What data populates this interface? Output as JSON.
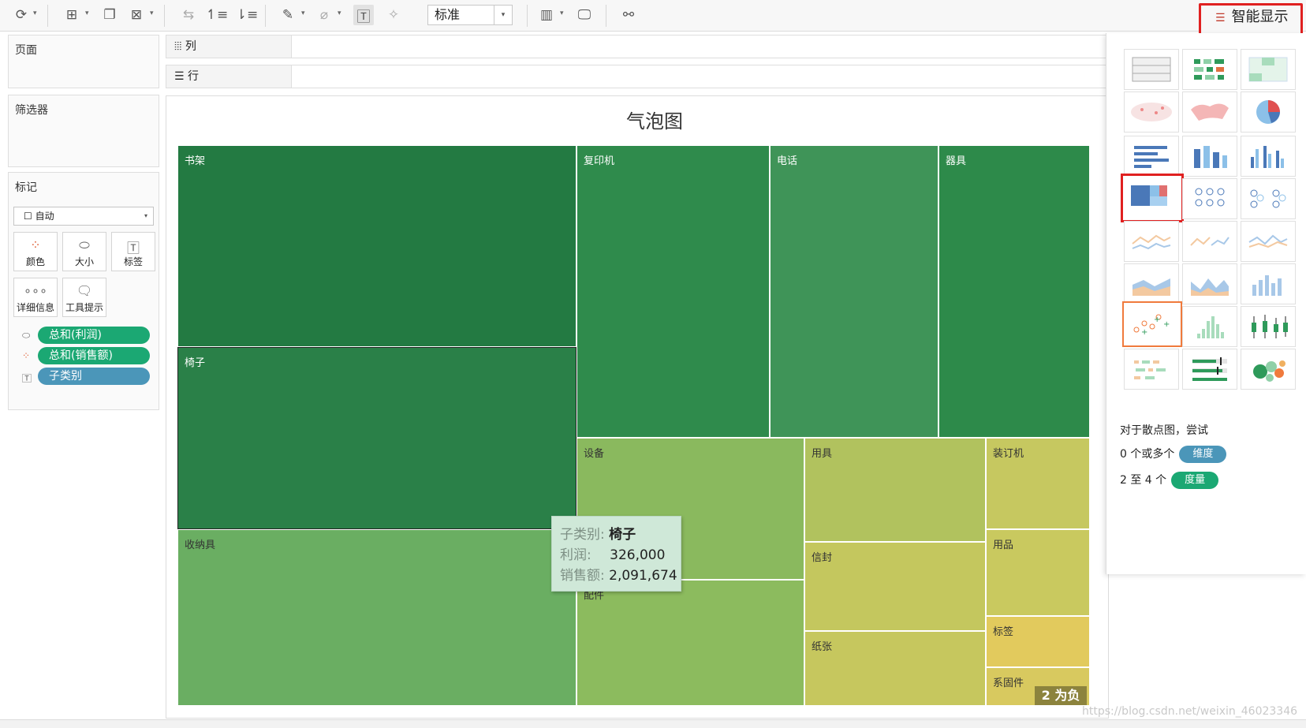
{
  "toolbar": {
    "fit_value": "标准",
    "show_me_label": "智能显示",
    "icons": [
      "refresh-icon",
      "new-worksheet-icon",
      "duplicate-sheet-icon",
      "clear-sheet-icon",
      "swap-axes-icon",
      "sort-ascending-icon",
      "sort-descending-icon",
      "highlight-icon",
      "group-icon",
      "show-labels-icon",
      "fix-axes-icon",
      "show-cards-icon",
      "presentation-icon",
      "share-icon"
    ]
  },
  "left": {
    "pages_title": "页面",
    "filters_title": "筛选器",
    "marks_title": "标记",
    "mark_type": "自动",
    "mark_buttons": [
      {
        "label": "颜色",
        "icon": "color-icon"
      },
      {
        "label": "大小",
        "icon": "size-icon"
      },
      {
        "label": "标签",
        "icon": "label-icon"
      },
      {
        "label": "详细信息",
        "icon": "detail-icon"
      },
      {
        "label": "工具提示",
        "icon": "tooltip-icon"
      }
    ],
    "pills": [
      {
        "label": "总和(利润)",
        "icon": "size-icon",
        "color": "#1ba873"
      },
      {
        "label": "总和(销售额)",
        "icon": "color-icon",
        "color": "#1ba873"
      },
      {
        "label": "子类别",
        "icon": "label-icon",
        "color": "#4b96b9"
      }
    ]
  },
  "shelves": {
    "columns_label": "列",
    "rows_label": "行"
  },
  "view": {
    "title": "气泡图",
    "cells": [
      {
        "name": "书架",
        "color": "#237a42"
      },
      {
        "name": "复印机",
        "color": "#2f8b4c"
      },
      {
        "name": "电话",
        "color": "#3f9458"
      },
      {
        "name": "器具",
        "color": "#2d8a4a"
      },
      {
        "name": "椅子",
        "color": "#2a8048"
      },
      {
        "name": "收纳具",
        "color": "#6aae62"
      },
      {
        "name": "设备",
        "color": "#8ab95e"
      },
      {
        "name": "配件",
        "color": "#8cbb5e"
      },
      {
        "name": "用具",
        "color": "#b1c25e"
      },
      {
        "name": "信封",
        "color": "#c4c75e"
      },
      {
        "name": "纸张",
        "color": "#c6c75e"
      },
      {
        "name": "装订机",
        "color": "#c6c860"
      },
      {
        "name": "用品",
        "color": "#c9c95f"
      },
      {
        "name": "标签",
        "color": "#e2ca5d"
      },
      {
        "name": "系固件",
        "color": "#d8c95f"
      }
    ],
    "tooltip": {
      "rows": [
        {
          "key": "子类别:",
          "value": "椅子"
        },
        {
          "key": "利润:",
          "value": "326,000"
        },
        {
          "key": "销售额:",
          "value": "2,091,674"
        }
      ]
    },
    "negative_badge": "2 为负"
  },
  "show_me": {
    "hint_title": "对于散点图，尝试",
    "hint_dims_prefix": "0 个或多个",
    "hint_dims_pill": "维度",
    "hint_measures_prefix": "2 至 4 个",
    "hint_measures_pill": "度量",
    "colors": {
      "dimension": "#4b96b9",
      "measure": "#1ba873"
    }
  },
  "watermark": "https://blog.csdn.net/weixin_46023346"
}
